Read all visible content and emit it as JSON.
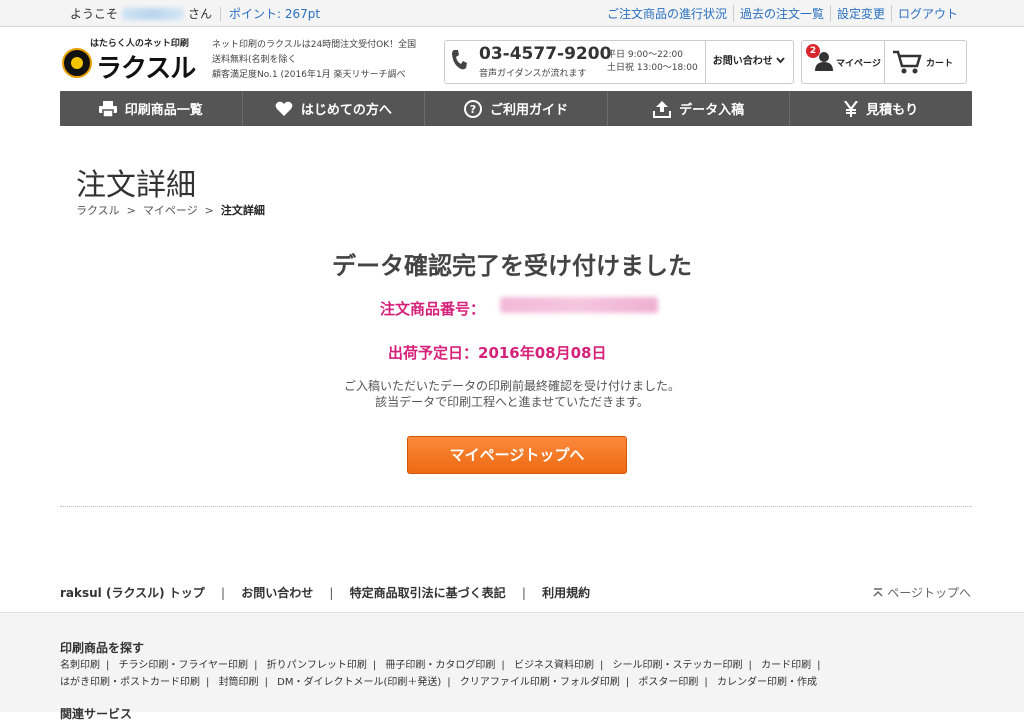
{
  "topbar": {
    "welcome": "ようこそ",
    "san": "さん",
    "points": "ポイント: 267pt",
    "links": [
      "ご注文商品の進行状況",
      "過去の注文一覧",
      "設定変更",
      "ログアウト"
    ]
  },
  "header": {
    "logo_tag": "はたらく人のネット印刷",
    "logo_text": "ラクスル",
    "desc": [
      "ネット印刷のラクスルは24時間注文受付OK！全国",
      "送料無料(名刺を除く",
      "顧客満足度No.1 (2016年1月 楽天リサーチ調べ"
    ],
    "phone": "03-4577-9200",
    "phone_sub": "音声ガイダンスが流れます",
    "hours": [
      "平日 9:00〜22:00",
      "土日祝 13:00〜18:00"
    ],
    "contact": "お問い合わせ",
    "badge": "2",
    "mypage": "マイページ",
    "cart": "カート"
  },
  "nav": [
    "印刷商品一覧",
    "はじめての方へ",
    "ご利用ガイド",
    "データ入稿",
    "見積もり"
  ],
  "main": {
    "title": "注文詳細",
    "breadcrumb": [
      "ラクスル",
      "マイページ",
      "注文詳細"
    ],
    "headline": "データ確認完了を受け付けました",
    "order_label": "注文商品番号：",
    "ship": "出荷予定日：2016年08月08日",
    "msg1": "ご入稿いただいたデータの印刷前最終確認を受け付けました。",
    "msg2": "該当データで印刷工程へと進ませていただきます。",
    "cta": "マイページトップへ"
  },
  "footer": {
    "links": [
      "raksul (ラクスル) トップ",
      "お問い合わせ",
      "特定商品取引法に基づく表記",
      "利用規約"
    ],
    "pagetop": "ページトップへ",
    "heading": "印刷商品を探す",
    "row1": [
      "名刺印刷",
      "チラシ印刷・フライヤー印刷",
      "折りパンフレット印刷",
      "冊子印刷・カタログ印刷",
      "ビジネス資料印刷",
      "シール印刷・ステッカー印刷",
      "カード印刷"
    ],
    "row2": [
      "はがき印刷・ポストカード印刷",
      "封筒印刷",
      "DM・ダイレクトメール(印刷＋発送)",
      "クリアファイル印刷・フォルダ印刷",
      "ポスター印刷",
      "カレンダー印刷・作成"
    ],
    "heading2": "関連サービス"
  },
  "colors": {
    "accent": "#d6217a",
    "link": "#2a6fc0",
    "cta": "#f07a24",
    "nav": "#555555"
  }
}
